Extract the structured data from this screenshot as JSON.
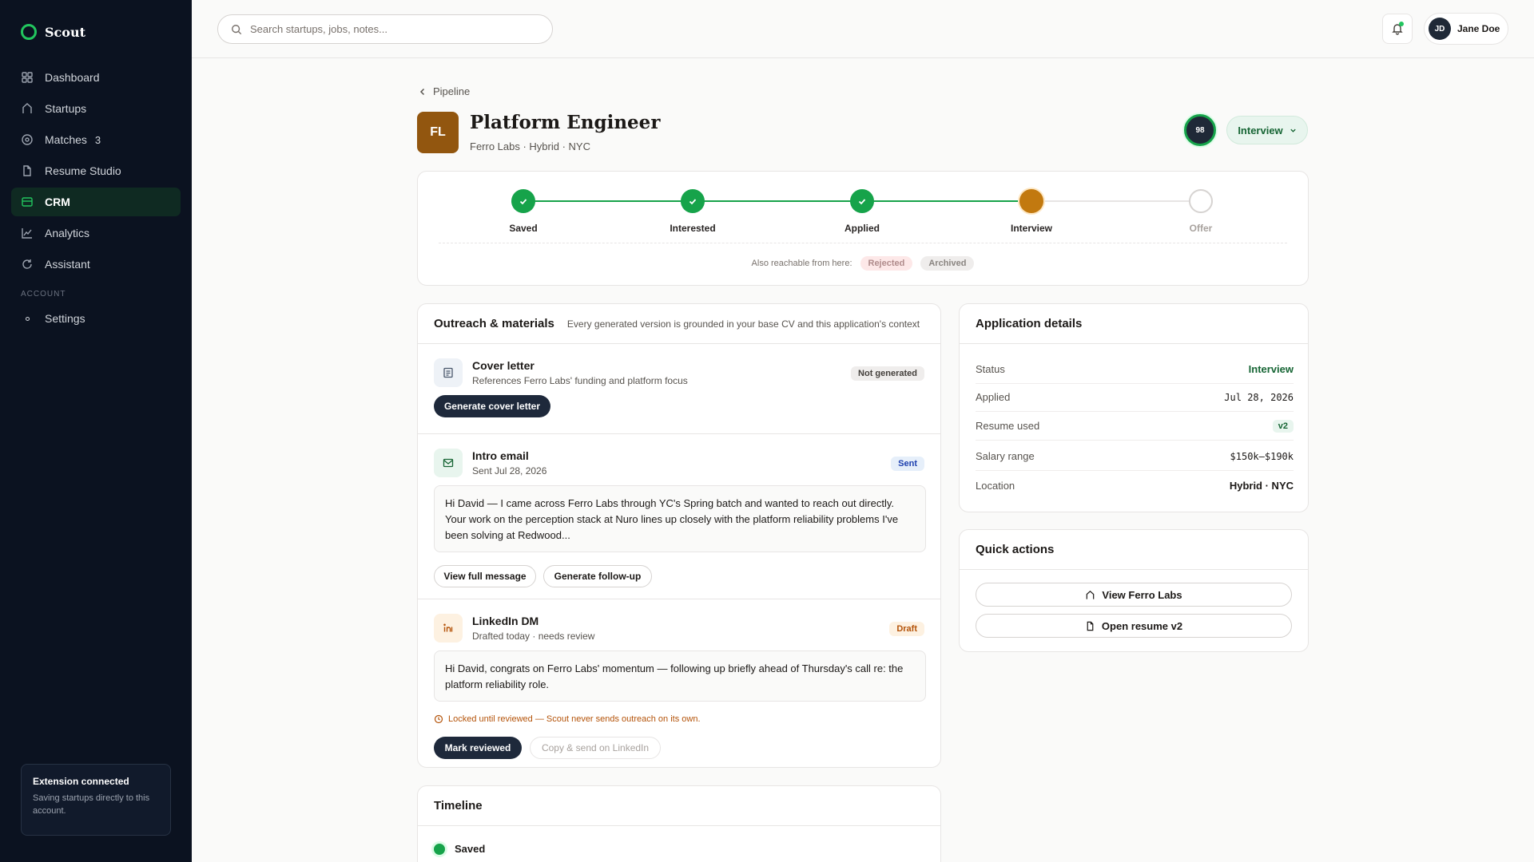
{
  "app": {
    "name": "Scout"
  },
  "sidebar": {
    "items": [
      {
        "label": "Dashboard",
        "icon": "grid-icon"
      },
      {
        "label": "Startups",
        "icon": "house-icon"
      },
      {
        "label": "Matches",
        "icon": "target-icon",
        "badge": "3"
      },
      {
        "label": "Resume Studio",
        "icon": "document-icon"
      },
      {
        "label": "CRM",
        "icon": "card-icon",
        "active": true
      },
      {
        "label": "Analytics",
        "icon": "chart-icon"
      },
      {
        "label": "Assistant",
        "icon": "refresh-icon"
      }
    ],
    "section_label": "ACCOUNT",
    "settings_label": "Settings",
    "extension": {
      "title": "Extension connected",
      "subtitle": "Saving startups directly to this account."
    }
  },
  "topbar": {
    "search_placeholder": "Search startups, jobs, notes...",
    "user": {
      "initials": "JD",
      "name": "Jane Doe"
    }
  },
  "header": {
    "breadcrumb": "Pipeline",
    "company_initials": "FL",
    "job_title": "Platform Engineer",
    "job_subtitle": "Ferro Labs · Hybrid · NYC",
    "score": "98",
    "status": "Interview"
  },
  "stepper": {
    "steps": [
      {
        "label": "Saved",
        "state": "done"
      },
      {
        "label": "Interested",
        "state": "done"
      },
      {
        "label": "Applied",
        "state": "done"
      },
      {
        "label": "Interview",
        "state": "current"
      },
      {
        "label": "Offer",
        "state": "future"
      }
    ],
    "reach_label": "Also reachable from here:",
    "reach_tags": [
      "Rejected",
      "Archived"
    ]
  },
  "outreach": {
    "title": "Outreach & materials",
    "note": "Every generated version is grounded in your base CV and this application's context",
    "cover": {
      "title": "Cover letter",
      "subtitle": "References Ferro Labs' funding and platform focus",
      "badge": "Not generated",
      "button": "Generate cover letter"
    },
    "email": {
      "title": "Intro email",
      "subtitle": "Sent Jul 28, 2026",
      "badge": "Sent",
      "message": "Hi David — I came across Ferro Labs through YC's Spring batch and wanted to reach out directly. Your work on the perception stack at Nuro lines up closely with the platform reliability problems I've been solving at Redwood...",
      "btn_view": "View full message",
      "btn_followup": "Generate follow-up"
    },
    "linkedin": {
      "title": "LinkedIn DM",
      "subtitle": "Drafted today · needs review",
      "badge": "Draft",
      "message": "Hi David, congrats on Ferro Labs' momentum — following up briefly ahead of Thursday's call re: the platform reliability role.",
      "lock_note": "Locked until reviewed — Scout never sends outreach on its own.",
      "btn_review": "Mark reviewed",
      "btn_send": "Copy & send on LinkedIn"
    }
  },
  "details": {
    "title": "Application details",
    "rows": [
      {
        "key": "Status",
        "value": "Interview"
      },
      {
        "key": "Applied",
        "value": "Jul 28, 2026"
      },
      {
        "key": "Resume used",
        "value": "v2"
      },
      {
        "key": "Salary range",
        "value": "$150k–$190k"
      },
      {
        "key": "Location",
        "value": "Hybrid · NYC"
      }
    ]
  },
  "quick_actions": {
    "title": "Quick actions",
    "view_company": "View Ferro Labs",
    "open_resume": "Open resume v2"
  },
  "timeline": {
    "title": "Timeline",
    "first_item": "Saved"
  },
  "colors": {
    "sidebar_bg": "#0b1220",
    "accent_green": "#16a34a",
    "interview_amber": "#c2790f",
    "company_brown": "#92560f"
  }
}
